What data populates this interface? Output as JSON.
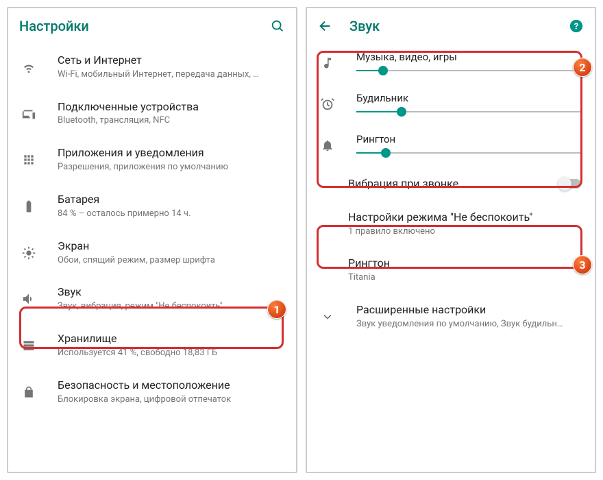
{
  "left": {
    "title": "Настройки",
    "items": [
      {
        "title": "Сеть и Интернет",
        "sub": "Wi-Fi, мобильный Интернет, передача данных, …"
      },
      {
        "title": "Подключенные устройства",
        "sub": "Bluetooth, трансляция, NFC"
      },
      {
        "title": "Приложения и уведомления",
        "sub": "Разрешения, приложения по умолчанию"
      },
      {
        "title": "Батарея",
        "sub": "84 % – осталось примерно 14 ч."
      },
      {
        "title": "Экран",
        "sub": "Обои, спящий режим, размер шрифта"
      },
      {
        "title": "Звук",
        "sub": "Звук, вибрация, режим \"Не беспокоить\""
      },
      {
        "title": "Хранилище",
        "sub": "Используется 41 %, свободно 18,83 ГБ"
      },
      {
        "title": "Безопасность и местоположение",
        "sub": "Блокировка экрана, цифровой отпечаток"
      }
    ]
  },
  "right": {
    "title": "Звук",
    "sliders": [
      {
        "label": "Музыка, видео, игры",
        "value": 12
      },
      {
        "label": "Будильник",
        "value": 20
      },
      {
        "label": "Рингтон",
        "value": 13
      }
    ],
    "vibrate": "Вибрация при звонке",
    "dnd": {
      "title": "Настройки режима \"Не беспокоить\"",
      "sub": "1 правило включено"
    },
    "ringtone": {
      "title": "Рингтон",
      "sub": "Titania"
    },
    "advanced": {
      "title": "Расширенные настройки",
      "sub": "Звук уведомления по умолчанию, Звук будильн…"
    }
  },
  "badges": {
    "b1": "1",
    "b2": "2",
    "b3": "3"
  }
}
